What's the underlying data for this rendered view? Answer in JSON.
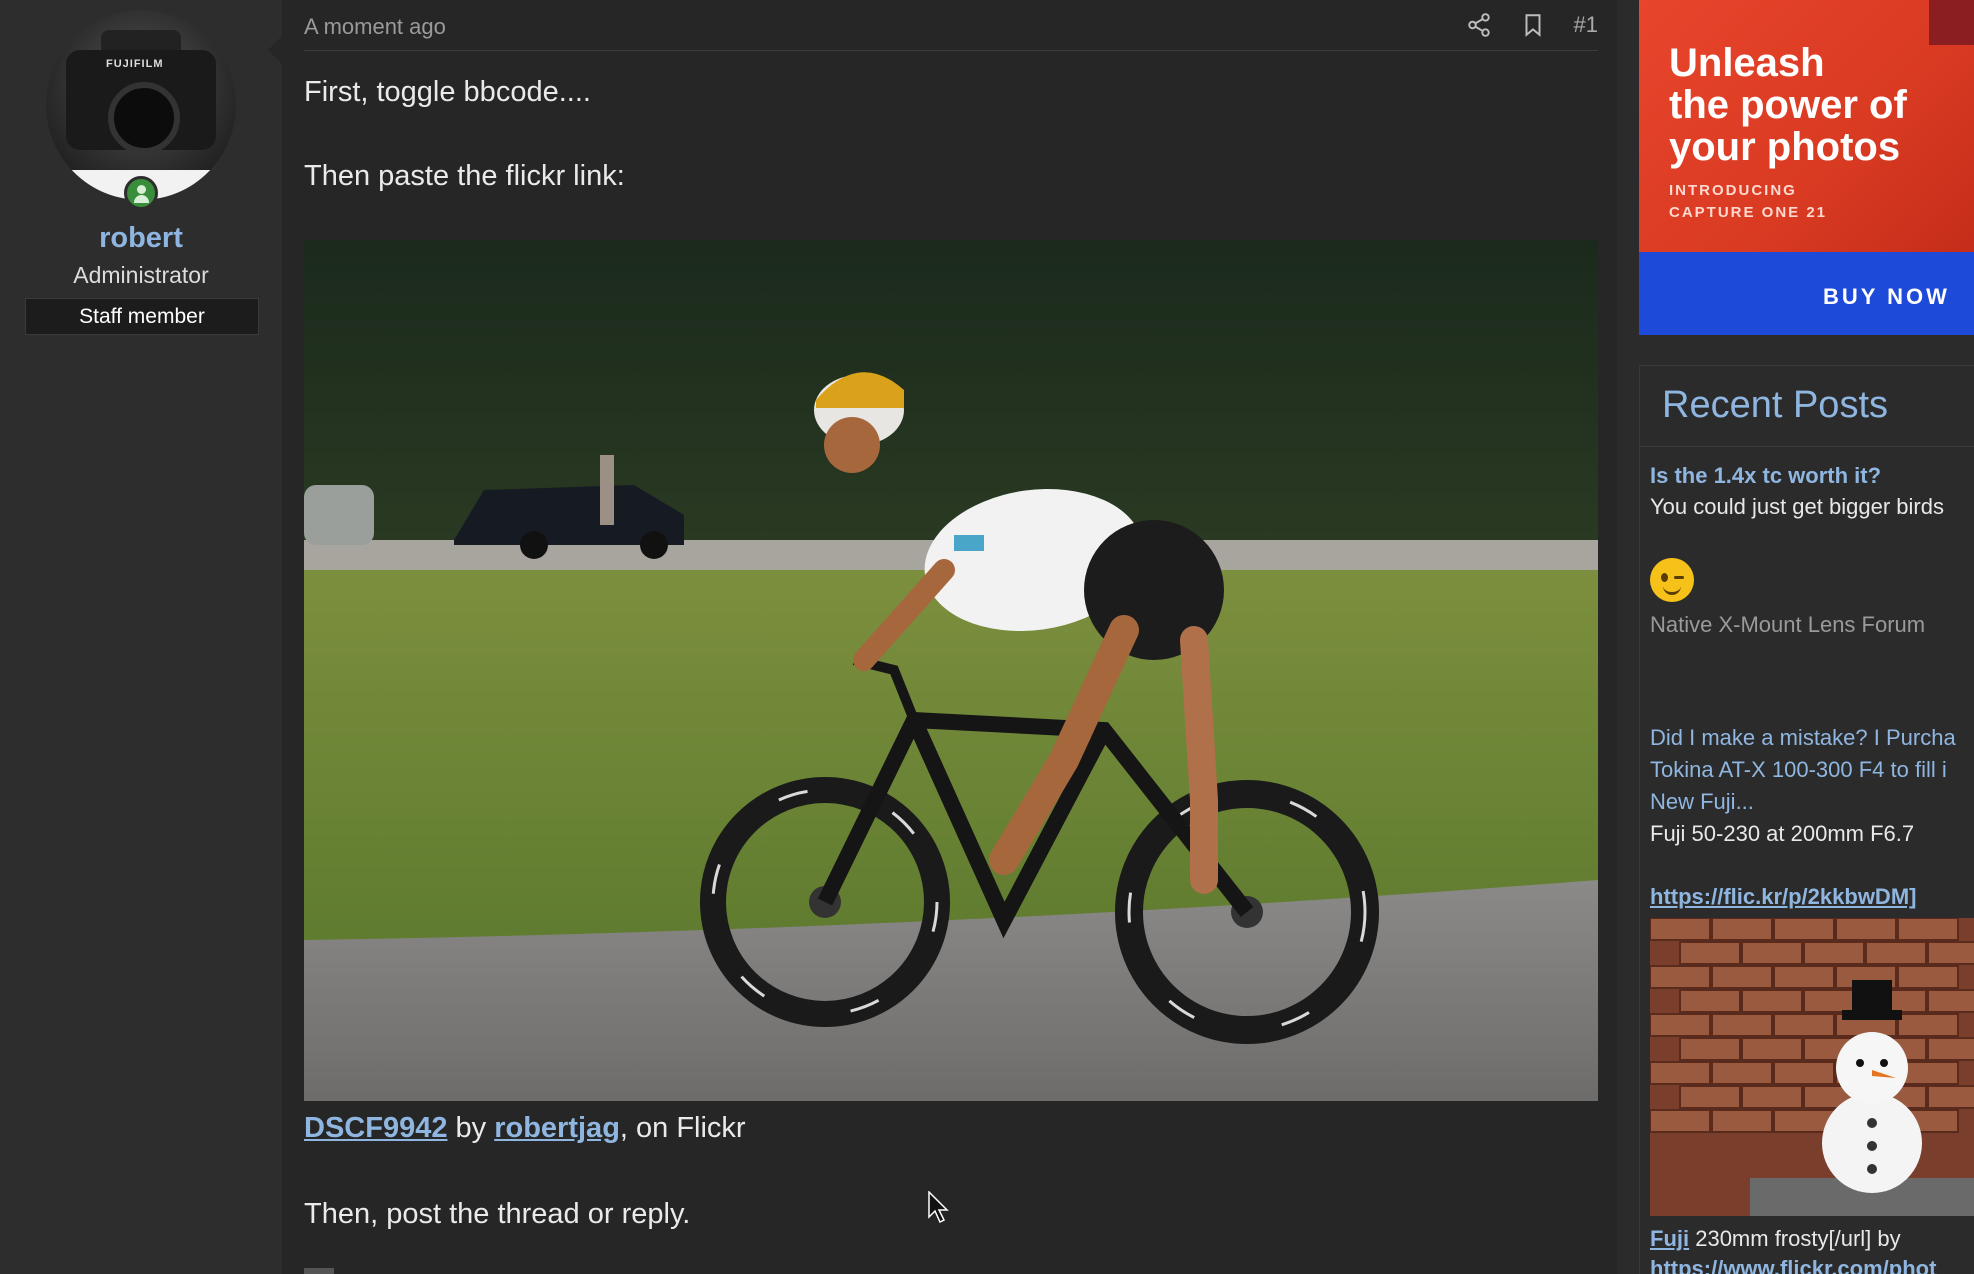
{
  "author": {
    "username": "robert",
    "role": "Administrator",
    "badge": "Staff member",
    "online": true
  },
  "post": {
    "timestamp": "A moment ago",
    "number": "#1",
    "line1": "First, toggle bbcode....",
    "line2": "Then paste the flickr link:",
    "caption_link1": "DSCF9942",
    "caption_by": " by ",
    "caption_link2": "robertjag",
    "caption_tail": ", on Flickr",
    "line4": "Then, post the thread or reply."
  },
  "ad": {
    "headline": "Unleash\nthe power of\nyour photos",
    "subline": "INTRODUCING\nCAPTURE ONE 21",
    "cta": "BUY NOW"
  },
  "recent_posts": {
    "title": "Recent Posts",
    "items": [
      {
        "title": "Is the 1.4x tc worth it?",
        "excerpt": "You could just get bigger birds",
        "forum": "Native X-Mount Lens Forum"
      },
      {
        "title_lines": [
          "Did I make a mistake? I Purcha",
          "Tokina AT-X 100-300 F4 to fill i",
          "New Fuji..."
        ],
        "excerpt": "Fuji 50-230 at 200mm F6.7",
        "link": "https://flic.kr/p/2kkbwDM]"
      },
      {
        "caption_link": "Fuji",
        "caption_text": " 230mm frosty[/url] by",
        "caption_link2": "https://www.flickr.com/phot"
      }
    ]
  },
  "colors": {
    "background": "#2b2b2b",
    "post_bg": "#262626",
    "link": "#8fb6e0",
    "online": "#3a8d3a",
    "ad_orange": "#e8452c",
    "ad_blue": "#1d4ad8"
  },
  "icons": [
    "share-icon",
    "bookmark-icon",
    "online-status-icon",
    "winking-emoji-icon",
    "mouse-cursor-icon"
  ]
}
